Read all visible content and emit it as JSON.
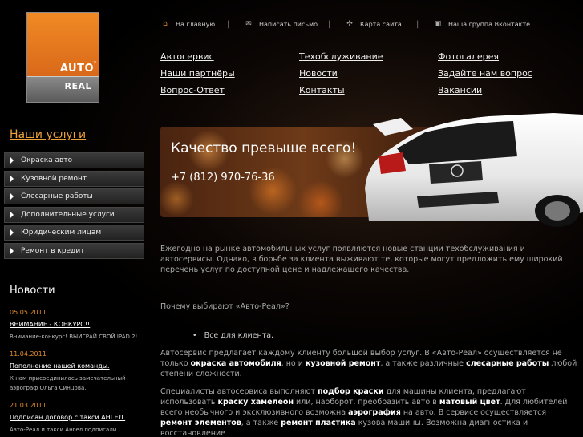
{
  "logo": {
    "line1": "AUTO",
    "tm": "™",
    "line2": "REAL"
  },
  "topbar": [
    {
      "label": "На главную",
      "icon": "home-icon"
    },
    {
      "label": "Написать письмо",
      "icon": "envelope-icon"
    },
    {
      "label": "Карта сайта",
      "icon": "sitemap-icon"
    },
    {
      "label": "Наша группа Вконтакте",
      "icon": "vk-icon"
    }
  ],
  "menu": [
    "Автосервис",
    "Техобслуживание",
    "Фотогалерея",
    "Наши партнёры",
    "Новости",
    "Задайте нам вопрос",
    "Вопрос-Ответ",
    "Контакты",
    "Вакансии"
  ],
  "banner": {
    "title": "Качество превыше всего!",
    "phone": "+7 (812) 970-76-36"
  },
  "sidebar": {
    "title": "Наши услуги",
    "items": [
      "Окраска авто",
      "Кузовной ремонт",
      "Слесарные работы",
      "Дополнительные услуги",
      "Юридическим лицам",
      "Ремонт в кредит"
    ]
  },
  "news": {
    "title": "Новости",
    "items": [
      {
        "date": "05.05.2011",
        "head": "ВНИМАНИЕ - КОНКУРС!!",
        "text": "Внимание-конкурс! ВЫИГРАЙ СВОЙ IPAD 2!"
      },
      {
        "date": "11.04.2011",
        "head": "Пополнение нашей команды.",
        "text": "К нам присоединилась замечательный\nаэрограф Ольга Синцова."
      },
      {
        "date": "21.03.2011",
        "head": "Подписан договор с такси АНГЕЛ.",
        "text": "Авто-Реал и такси Ангел подписали"
      }
    ]
  },
  "content": {
    "intro": "Ежегодно на рынке автомобильных услуг появляются новые станции техобслуживания и автосервисы. Однако, в борьбе за клиента выживают те, которые могут предложить ему широкий перечень услуг по доступной цене и надлежащего качества.",
    "question": "Почему выбирают «Авто-Реал»?",
    "bullet": "Все для клиента.",
    "p1_a": "Автосервис предлагает каждому клиенту большой выбор услуг. В «Авто-Реал» осуществляется не только ",
    "p1_b1": "окраска автомобиля",
    "p1_c": ", но и ",
    "p1_b2": "кузовной ремонт",
    "p1_d": ", а также различные ",
    "p1_b3": "слесарные работы",
    "p1_e": " любой степени сложности.",
    "p2_a": "Специалисты автосервиса выполняют ",
    "p2_b1": "подбор краски",
    "p2_c": " для машины клиента, предлагают использовать ",
    "p2_b2": "краску хамелеон",
    "p2_d": " или, наоборот, преобразить авто в ",
    "p2_b3": "матовый цвет",
    "p2_e": ". Для любителей всего необычного и эксклюзивного возможна ",
    "p2_b4": "аэрография",
    "p2_f": " на авто. В сервисе осуществляется ",
    "p2_b5": "ремонт элементов",
    "p2_g": ", а также ",
    "p2_b6": "ремонт пластика",
    "p2_h": " кузова машины. Возможна диагностика и восстановление"
  }
}
